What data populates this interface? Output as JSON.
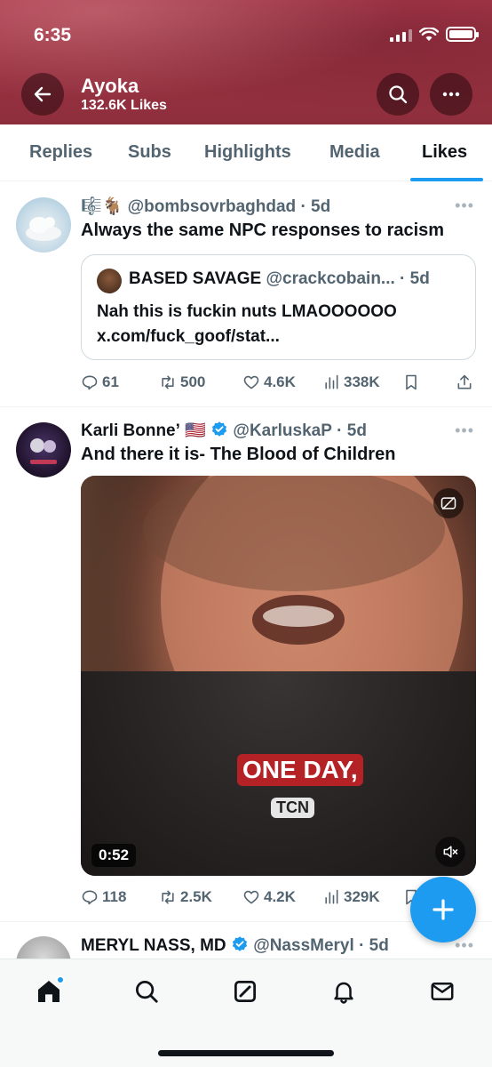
{
  "status_bar": {
    "time": "6:35"
  },
  "header": {
    "name": "Ayoka",
    "likes_count": "132.6K Likes",
    "accent_color": "#9b3242"
  },
  "tabs": [
    {
      "label": "Replies",
      "active": false
    },
    {
      "label": "Subs",
      "active": false
    },
    {
      "label": "Highlights",
      "active": false
    },
    {
      "label": "Media",
      "active": false
    },
    {
      "label": "Likes",
      "active": true
    }
  ],
  "posts": [
    {
      "name_emoji": "🎼🐐",
      "handle": "@bombsovrbaghdad",
      "time": "· 5d",
      "text": "Always the same NPC responses to racism",
      "quote": {
        "name": "BASED SAVAGE",
        "handle": "@crackcobain...",
        "time": "· 5d",
        "line1": "Nah this is fuckin nuts LMAOOOOOO",
        "line2": "x.com/fuck_goof/stat..."
      },
      "stats": {
        "replies": "61",
        "reposts": "500",
        "likes": "4.6K",
        "views": "338K"
      }
    },
    {
      "name": "Karli Bonne’",
      "flag": "🇺🇸",
      "handle": "@KarluskaP",
      "time": "· 5d",
      "text": "And there it is- The Blood of Children",
      "video": {
        "caption": "ONE DAY,",
        "watermark": "TCN",
        "duration": "0:52"
      },
      "stats": {
        "replies": "118",
        "reposts": "2.5K",
        "likes": "4.2K",
        "views": "329K"
      }
    },
    {
      "name": "MERYL NASS, MD",
      "handle": "@NassMeryl",
      "time": "· 5d"
    }
  ],
  "icons": {
    "back": "arrow-left-icon",
    "search": "search-icon",
    "more": "more-icon",
    "fab": "plus-icon",
    "nav": [
      "home-icon",
      "search-icon",
      "grok-icon",
      "bell-icon",
      "mail-icon"
    ]
  }
}
